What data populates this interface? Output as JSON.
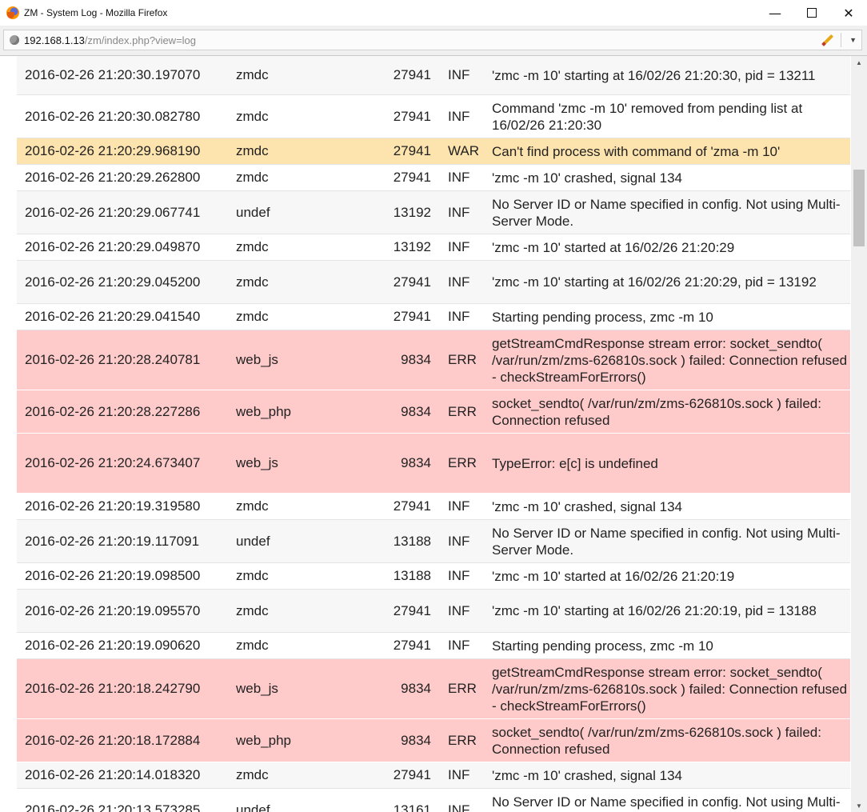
{
  "window": {
    "title": "ZM - System Log - Mozilla Firefox",
    "minimize": "—",
    "close": "✕"
  },
  "urlbar": {
    "host": "192.168.1.13",
    "path": "/zm/index.php?view=log",
    "dropdown": "▼"
  },
  "log": [
    {
      "time": "2016-02-26 21:20:30.197070",
      "component": "zmdc",
      "pid": "27941",
      "level": "INF",
      "message": "'zmc -m 10' starting at 16/02/26 21:20:30, pid = 13211"
    },
    {
      "time": "2016-02-26 21:20:30.082780",
      "component": "zmdc",
      "pid": "27941",
      "level": "INF",
      "message": "Command 'zmc -m 10' removed from pending list at 16/02/26 21:20:30"
    },
    {
      "time": "2016-02-26 21:20:29.968190",
      "component": "zmdc",
      "pid": "27941",
      "level": "WAR",
      "message": "Can't find process with command of 'zma -m 10'"
    },
    {
      "time": "2016-02-26 21:20:29.262800",
      "component": "zmdc",
      "pid": "27941",
      "level": "INF",
      "message": "'zmc -m 10' crashed, signal 134"
    },
    {
      "time": "2016-02-26 21:20:29.067741",
      "component": "undef",
      "pid": "13192",
      "level": "INF",
      "message": "No Server ID or Name specified in config. Not using Multi-Server Mode."
    },
    {
      "time": "2016-02-26 21:20:29.049870",
      "component": "zmdc",
      "pid": "13192",
      "level": "INF",
      "message": "'zmc -m 10' started at 16/02/26 21:20:29"
    },
    {
      "time": "2016-02-26 21:20:29.045200",
      "component": "zmdc",
      "pid": "27941",
      "level": "INF",
      "message": "'zmc -m 10' starting at 16/02/26 21:20:29, pid = 13192"
    },
    {
      "time": "2016-02-26 21:20:29.041540",
      "component": "zmdc",
      "pid": "27941",
      "level": "INF",
      "message": "Starting pending process, zmc -m 10"
    },
    {
      "time": "2016-02-26 21:20:28.240781",
      "component": "web_js",
      "pid": "9834",
      "level": "ERR",
      "message": "getStreamCmdResponse stream error: socket_sendto( /var/run/zm/zms-626810s.sock ) failed: Connection refused - checkStreamForErrors()"
    },
    {
      "time": "2016-02-26 21:20:28.227286",
      "component": "web_php",
      "pid": "9834",
      "level": "ERR",
      "message": "socket_sendto( /var/run/zm/zms-626810s.sock ) failed: Connection refused"
    },
    {
      "time": "2016-02-26 21:20:24.673407",
      "component": "web_js",
      "pid": "9834",
      "level": "ERR",
      "message": "TypeError: e[c] is undefined"
    },
    {
      "time": "2016-02-26 21:20:19.319580",
      "component": "zmdc",
      "pid": "27941",
      "level": "INF",
      "message": "'zmc -m 10' crashed, signal 134"
    },
    {
      "time": "2016-02-26 21:20:19.117091",
      "component": "undef",
      "pid": "13188",
      "level": "INF",
      "message": "No Server ID or Name specified in config. Not using Multi-Server Mode."
    },
    {
      "time": "2016-02-26 21:20:19.098500",
      "component": "zmdc",
      "pid": "13188",
      "level": "INF",
      "message": "'zmc -m 10' started at 16/02/26 21:20:19"
    },
    {
      "time": "2016-02-26 21:20:19.095570",
      "component": "zmdc",
      "pid": "27941",
      "level": "INF",
      "message": "'zmc -m 10' starting at 16/02/26 21:20:19, pid = 13188"
    },
    {
      "time": "2016-02-26 21:20:19.090620",
      "component": "zmdc",
      "pid": "27941",
      "level": "INF",
      "message": "Starting pending process, zmc -m 10"
    },
    {
      "time": "2016-02-26 21:20:18.242790",
      "component": "web_js",
      "pid": "9834",
      "level": "ERR",
      "message": "getStreamCmdResponse stream error: socket_sendto( /var/run/zm/zms-626810s.sock ) failed: Connection refused - checkStreamForErrors()"
    },
    {
      "time": "2016-02-26 21:20:18.172884",
      "component": "web_php",
      "pid": "9834",
      "level": "ERR",
      "message": "socket_sendto( /var/run/zm/zms-626810s.sock ) failed: Connection refused"
    },
    {
      "time": "2016-02-26 21:20:14.018320",
      "component": "zmdc",
      "pid": "27941",
      "level": "INF",
      "message": "'zmc -m 10' crashed, signal 134"
    },
    {
      "time": "2016-02-26 21:20:13.573285",
      "component": "undef",
      "pid": "13161",
      "level": "INF",
      "message": "No Server ID or Name specified in config. Not using Multi-Server Mode."
    }
  ],
  "colors": {
    "inf_odd": "#f7f7f7",
    "inf_even": "#ffffff",
    "war": "#fde3ad",
    "err": "#ffcaca"
  }
}
